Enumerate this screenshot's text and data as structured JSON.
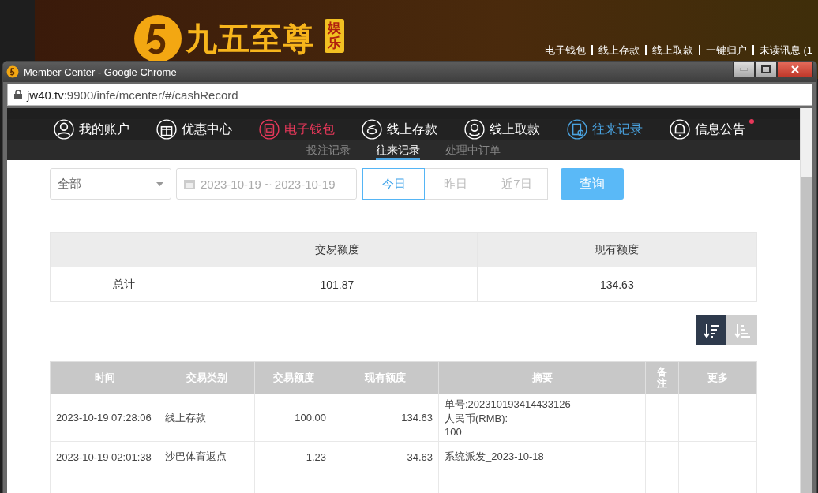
{
  "background_site": {
    "logo_text": "九五至尊",
    "logo_badge": "娱乐",
    "top_links": [
      "电子钱包",
      "线上存款",
      "线上取款",
      "一键归户",
      "未读讯息 (1"
    ]
  },
  "window": {
    "title": "Member Center - Google Chrome",
    "url_host": "jw40.tv",
    "url_path": ":9900/infe/mcenter/#/cashRecord"
  },
  "nav": [
    {
      "kind": "user",
      "label": "我的账户",
      "color": "#ffffff",
      "badge": false
    },
    {
      "kind": "gift",
      "label": "优惠中心",
      "color": "#ffffff",
      "badge": false
    },
    {
      "kind": "wallet",
      "label": "电子钱包",
      "color": "#e8385a",
      "badge": false
    },
    {
      "kind": "deposit",
      "label": "线上存款",
      "color": "#ffffff",
      "badge": false
    },
    {
      "kind": "withdraw",
      "label": "线上取款",
      "color": "#ffffff",
      "badge": false
    },
    {
      "kind": "record",
      "label": "往来记录",
      "color": "#4aa3e0",
      "badge": false
    },
    {
      "kind": "bell",
      "label": "信息公告",
      "color": "#ffffff",
      "badge": true
    }
  ],
  "subtabs": [
    {
      "label": "投注记录",
      "selected": false
    },
    {
      "label": "往来记录",
      "selected": true
    },
    {
      "label": "处理中订单",
      "selected": false
    }
  ],
  "filters": {
    "type_select": "全部",
    "date_range": "2023-10-19 ~ 2023-10-19",
    "quick_ranges": [
      {
        "label": "今日",
        "selected": true
      },
      {
        "label": "昨日",
        "selected": false
      },
      {
        "label": "近7日",
        "selected": false
      }
    ],
    "query_button": "查询"
  },
  "summary": {
    "columns": [
      "交易额度",
      "现有额度"
    ],
    "rows": [
      {
        "label": "总计",
        "values": [
          "101.87",
          "134.63"
        ]
      }
    ]
  },
  "sort_buttons": [
    {
      "kind": "desc",
      "selected": true
    },
    {
      "kind": "asc",
      "selected": false
    }
  ],
  "records": {
    "columns": [
      "时间",
      "交易类别",
      "交易额度",
      "现有额度",
      "摘要",
      "备注",
      "更多"
    ],
    "rows": [
      {
        "time": "2023-10-19 07:28:06",
        "type": "线上存款",
        "amount": "100.00",
        "balance": "134.63",
        "summary": [
          "单号:202310193414433126",
          "人民币(RMB):",
          "100"
        ]
      },
      {
        "time": "2023-10-19 02:01:38",
        "type": "沙巴体育返点",
        "amount": "1.23",
        "balance": "34.63",
        "summary": [
          "系统派发_2023-10-18"
        ]
      }
    ]
  }
}
